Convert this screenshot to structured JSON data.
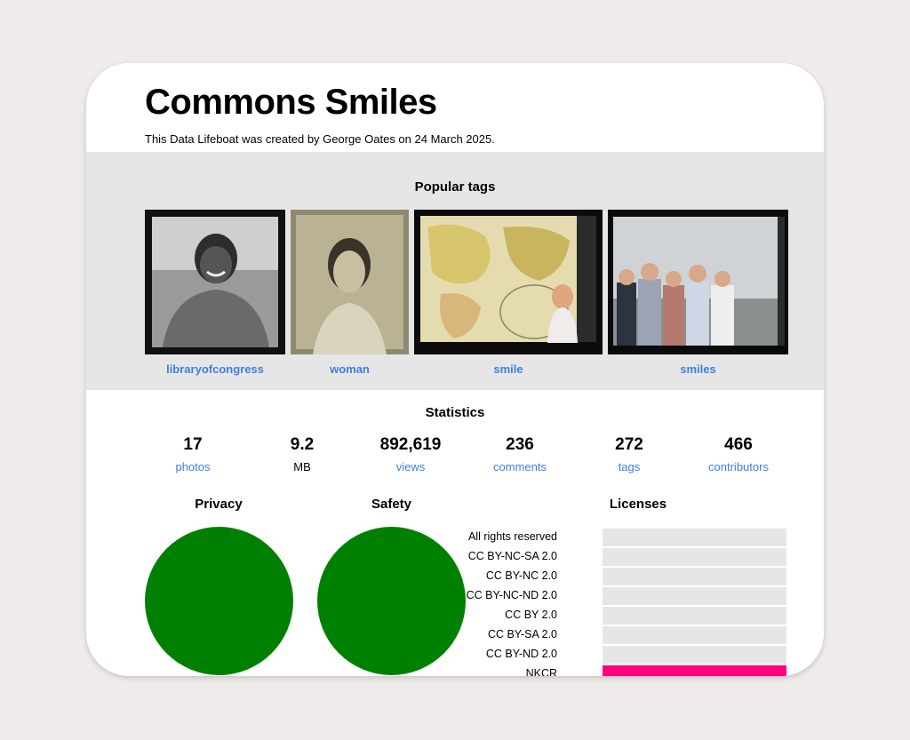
{
  "header": {
    "title": "Commons Smiles",
    "subtitle": "This Data Lifeboat was created by George Oates on 24 March 2025."
  },
  "popular_tags": {
    "heading": "Popular tags",
    "items": [
      {
        "label": "libraryofcongress",
        "icon": "portrait-photo-icon"
      },
      {
        "label": "woman",
        "icon": "tintype-portrait-icon"
      },
      {
        "label": "smile",
        "icon": "world-map-photo-icon"
      },
      {
        "label": "smiles",
        "icon": "group-photo-icon"
      }
    ]
  },
  "statistics": {
    "heading": "Statistics",
    "items": [
      {
        "value": "17",
        "label": "photos"
      },
      {
        "value": "9.2",
        "label": "MB"
      },
      {
        "value": "892,619",
        "label": "views"
      },
      {
        "value": "236",
        "label": "comments"
      },
      {
        "value": "272",
        "label": "tags"
      },
      {
        "value": "466",
        "label": "contributors"
      }
    ]
  },
  "privacy": {
    "heading": "Privacy",
    "color": "#008000",
    "fraction": 1.0
  },
  "safety": {
    "heading": "Safety",
    "color": "#008000",
    "fraction": 1.0
  },
  "licenses": {
    "heading": "Licenses",
    "bar_color": "#ff0080",
    "items": [
      {
        "name": "All rights reserved",
        "fraction": 0
      },
      {
        "name": "CC BY-NC-SA 2.0",
        "fraction": 0
      },
      {
        "name": "CC BY-NC 2.0",
        "fraction": 0
      },
      {
        "name": "CC BY-NC-ND 2.0",
        "fraction": 0
      },
      {
        "name": "CC BY 2.0",
        "fraction": 0
      },
      {
        "name": "CC BY-SA 2.0",
        "fraction": 0
      },
      {
        "name": "CC BY-ND 2.0",
        "fraction": 0
      },
      {
        "name": "NKCR",
        "fraction": 1.0
      }
    ]
  }
}
